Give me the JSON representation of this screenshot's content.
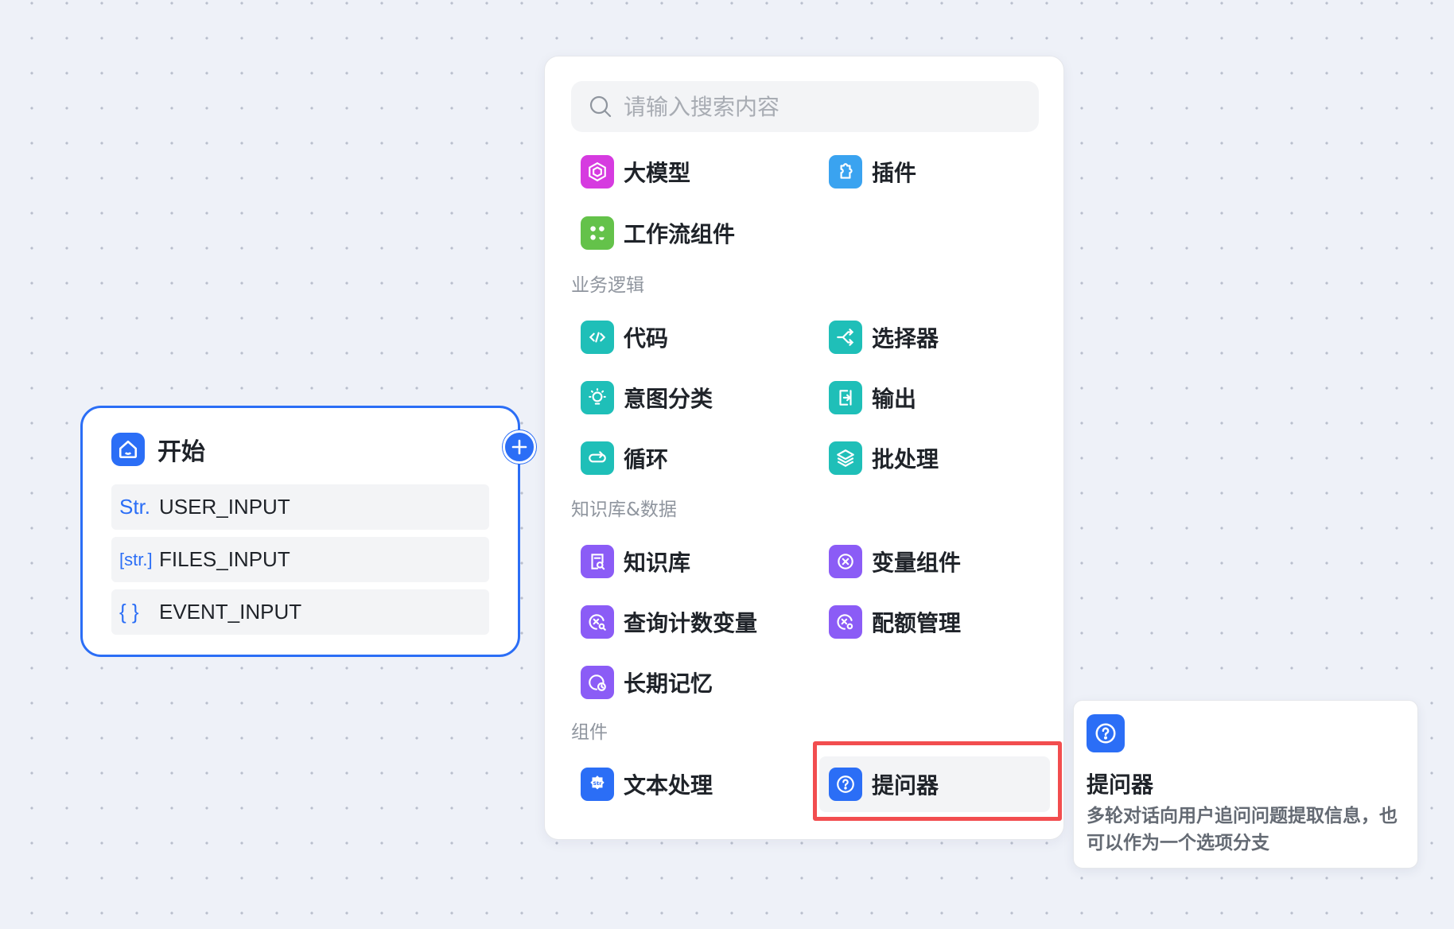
{
  "start_node": {
    "title": "开始",
    "variables": [
      {
        "type": "Str.",
        "name": "USER_INPUT"
      },
      {
        "type": "[str.]",
        "name": "FILES_INPUT"
      },
      {
        "type": "{ }",
        "name": "EVENT_INPUT"
      }
    ]
  },
  "panel": {
    "search_placeholder": "请输入搜索内容",
    "top_items": [
      {
        "label": "大模型",
        "icon": "llm-icon",
        "color": "#d63be0"
      },
      {
        "label": "插件",
        "icon": "plugin-icon",
        "color": "#3aa3f0"
      },
      {
        "label": "工作流组件",
        "icon": "workflow-icon",
        "color": "#64c24a"
      }
    ],
    "sections": [
      {
        "title": "业务逻辑",
        "items": [
          {
            "label": "代码",
            "icon": "code-icon",
            "color": "#1fbfb8"
          },
          {
            "label": "选择器",
            "icon": "selector-icon",
            "color": "#1fbfb8"
          },
          {
            "label": "意图分类",
            "icon": "intent-icon",
            "color": "#1fbfb8"
          },
          {
            "label": "输出",
            "icon": "output-icon",
            "color": "#1fbfb8"
          },
          {
            "label": "循环",
            "icon": "loop-icon",
            "color": "#1fbfb8"
          },
          {
            "label": "批处理",
            "icon": "batch-icon",
            "color": "#1fbfb8"
          }
        ]
      },
      {
        "title": "知识库&数据",
        "items": [
          {
            "label": "知识库",
            "icon": "knowledge-icon",
            "color": "#8b5cf6"
          },
          {
            "label": "变量组件",
            "icon": "variable-icon",
            "color": "#8b5cf6"
          },
          {
            "label": "查询计数变量",
            "icon": "count-query-icon",
            "color": "#8b5cf6"
          },
          {
            "label": "配额管理",
            "icon": "quota-icon",
            "color": "#8b5cf6"
          },
          {
            "label": "长期记忆",
            "icon": "memory-icon",
            "color": "#8b5cf6"
          }
        ]
      },
      {
        "title": "组件",
        "items": [
          {
            "label": "文本处理",
            "icon": "text-process-icon",
            "color": "#2b6ef6"
          },
          {
            "label": "提问器",
            "icon": "question-icon",
            "color": "#2b6ef6"
          }
        ]
      }
    ]
  },
  "tooltip": {
    "title": "提问器",
    "description": "多轮对话向用户追问问题提取信息，也可以作为一个选项分支"
  },
  "colors": {
    "accent": "#2b6ef6",
    "highlight": "#f24d4f"
  }
}
